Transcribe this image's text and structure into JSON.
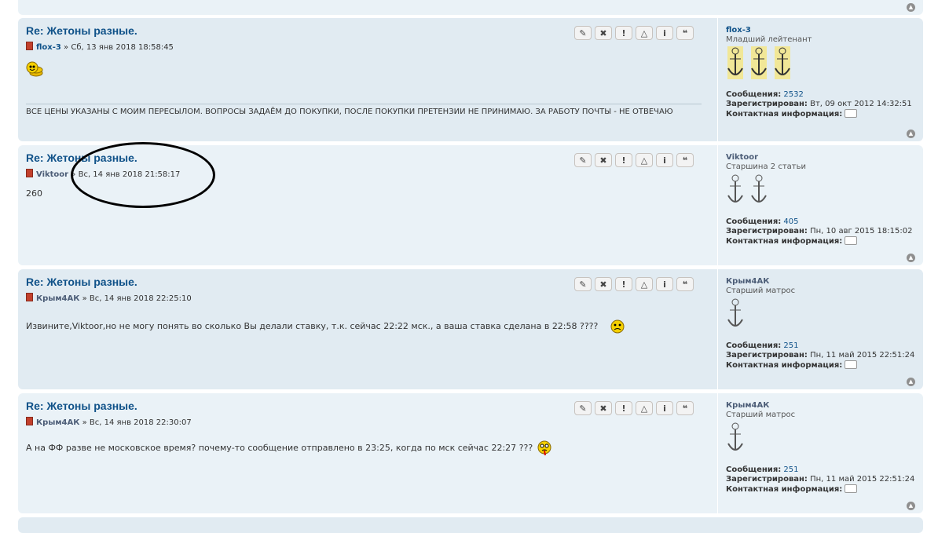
{
  "toolbar_icons": [
    "edit-icon",
    "delete-icon",
    "report-icon",
    "warn-icon",
    "info-icon",
    "quote-icon"
  ],
  "toolbar_glyphs": [
    "✎",
    "✖",
    "!",
    "△",
    "i",
    "❝"
  ],
  "labels": {
    "posts": "Сообщения:",
    "registered": "Зарегистрирован:",
    "contact": "Контактная информация:",
    "meta_sep": "»"
  },
  "posts": [
    {
      "title": "Re: Жетоны разные.",
      "author": "flox-3",
      "datetime": "Сб, 13 янв 2018 18:58:45",
      "body": "",
      "signature": "ВСЕ ЦЕНЫ УКАЗАНЫ С МОИМ ПЕРЕСЫЛОМ. ВОПРОСЫ ЗАДАЁМ ДО ПОКУПКИ, ПОСЛЕ ПОКУПКИ ПРЕТЕНЗИИ НЕ ПРИНИМАЮ. ЗА РАБОТУ ПОЧТЫ - НЕ ОТВЕЧАЮ",
      "profile": {
        "name": "flox-3",
        "rank": "Младший лейтенант",
        "posts": "2532",
        "registered": "Вт, 09 окт 2012 14:32:51"
      }
    },
    {
      "title": "Re: Жетоны разные.",
      "author": "Viktoor",
      "datetime": "Вс, 14 янв 2018 21:58:17",
      "body": "260",
      "profile": {
        "name": "Viktoor",
        "rank": "Старшина 2 статьи",
        "posts": "405",
        "registered": "Пн, 10 авг 2015 18:15:02"
      }
    },
    {
      "title": "Re: Жетоны разные.",
      "author": "Крым4АК",
      "datetime": "Вс, 14 янв 2018 22:25:10",
      "body": "Извините,Viktoor,но не могу понять во сколько Вы делали ставку, т.к. сейчас 22:22 мск., а ваша ставка сделана в 22:58 ????",
      "profile": {
        "name": "Крым4АК",
        "rank": "Старший матрос",
        "posts": "251",
        "registered": "Пн, 11 май 2015 22:51:24"
      }
    },
    {
      "title": "Re: Жетоны разные.",
      "author": "Крым4АК",
      "datetime": "Вс, 14 янв 2018 22:30:07",
      "body": "А на ФФ разве не московское время? почему-то сообщение отправлено в 23:25, когда по мск сейчас 22:27 ???",
      "profile": {
        "name": "Крым4АК",
        "rank": "Старший матрос",
        "posts": "251",
        "registered": "Пн, 11 май 2015 22:51:24"
      }
    }
  ]
}
